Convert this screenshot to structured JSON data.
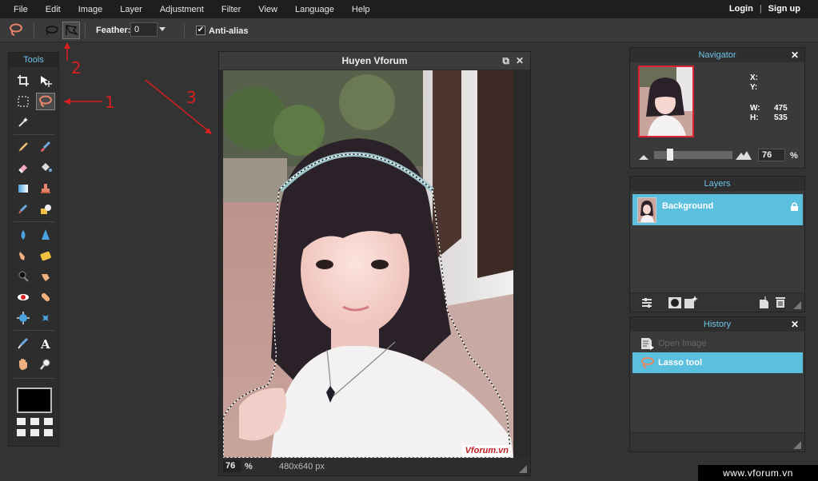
{
  "menu": {
    "items": [
      "File",
      "Edit",
      "Image",
      "Layer",
      "Adjustment",
      "Filter",
      "View",
      "Language",
      "Help"
    ],
    "login": "Login",
    "separator": "|",
    "signup": "Sign up"
  },
  "options": {
    "feather_label": "Feather:",
    "feather_value": "0",
    "antialias_label": "Anti-alias",
    "antialias_checked": true
  },
  "tools": {
    "title": "Tools",
    "selected": "lasso-tool",
    "foreground_color": "#000000"
  },
  "image_window": {
    "title": "Huyen Vforum",
    "zoom": "76",
    "zoom_unit": "%",
    "dimensions": "480x640 px",
    "watermark": "Vforum.vn"
  },
  "navigator": {
    "title": "Navigator",
    "x_label": "X:",
    "y_label": "Y:",
    "w_label": "W:",
    "w_value": "475",
    "h_label": "H:",
    "h_value": "535",
    "zoom": "76",
    "zoom_unit": "%"
  },
  "layers": {
    "title": "Layers",
    "items": [
      {
        "name": "Background",
        "locked": true
      }
    ]
  },
  "history": {
    "title": "History",
    "items": [
      {
        "label": "Open Image",
        "active": false
      },
      {
        "label": "Lasso tool",
        "active": true
      }
    ]
  },
  "annotations": {
    "one": "1",
    "two": "2",
    "three": "3"
  },
  "footer_watermark": "www.vforum.vn",
  "colors": {
    "accent": "#5bc0de",
    "annotation": "#d81e1e"
  }
}
